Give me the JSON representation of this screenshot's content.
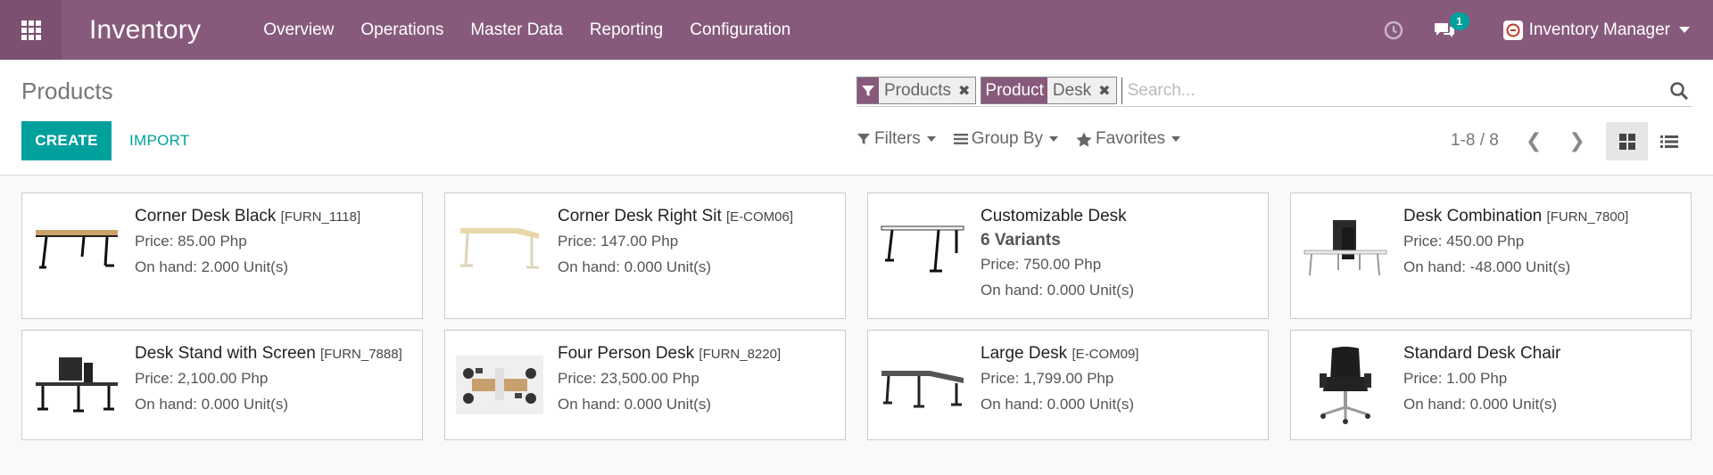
{
  "navbar": {
    "app_title": "Inventory",
    "menu": [
      "Overview",
      "Operations",
      "Master Data",
      "Reporting",
      "Configuration"
    ],
    "chat_count": "1",
    "user": "Inventory Manager",
    "accent_color": "#875a7b",
    "icons": [
      "apps-grid-icon",
      "clock-icon",
      "chat-icon",
      "company-logo"
    ]
  },
  "control_panel": {
    "title": "Products",
    "create_label": "CREATE",
    "import_label": "IMPORT",
    "search": {
      "facets": [
        {
          "category": "filter-icon",
          "value": "Products"
        },
        {
          "category": "Product",
          "value": "Desk"
        }
      ],
      "placeholder": "Search..."
    },
    "filters_label": "Filters",
    "groupby_label": "Group By",
    "favorites_label": "Favorites",
    "pager": "1-8 / 8"
  },
  "products": [
    {
      "name": "Corner Desk Black",
      "code": "[FURN_1118]",
      "variants": "",
      "price": "Price: 85.00 Php",
      "onhand": "On hand: 2.000 Unit(s)"
    },
    {
      "name": "Corner Desk Right Sit",
      "code": "[E-COM06]",
      "variants": "",
      "price": "Price: 147.00 Php",
      "onhand": "On hand: 0.000 Unit(s)"
    },
    {
      "name": "Customizable Desk",
      "code": "",
      "variants": "6 Variants",
      "price": "Price: 750.00 Php",
      "onhand": "On hand: 0.000 Unit(s)"
    },
    {
      "name": "Desk Combination",
      "code": "[FURN_7800]",
      "variants": "",
      "price": "Price: 450.00 Php",
      "onhand": "On hand: -48.000 Unit(s)"
    },
    {
      "name": "Desk Stand with Screen",
      "code": "[FURN_7888]",
      "variants": "",
      "price": "Price: 2,100.00 Php",
      "onhand": "On hand: 0.000 Unit(s)"
    },
    {
      "name": "Four Person Desk",
      "code": "[FURN_8220]",
      "variants": "",
      "price": "Price: 23,500.00 Php",
      "onhand": "On hand: 0.000 Unit(s)"
    },
    {
      "name": "Large Desk",
      "code": "[E-COM09]",
      "variants": "",
      "price": "Price: 1,799.00 Php",
      "onhand": "On hand: 0.000 Unit(s)"
    },
    {
      "name": "Standard Desk Chair",
      "code": "",
      "variants": "",
      "price": "Price: 1.00 Php",
      "onhand": "On hand: 0.000 Unit(s)"
    }
  ]
}
